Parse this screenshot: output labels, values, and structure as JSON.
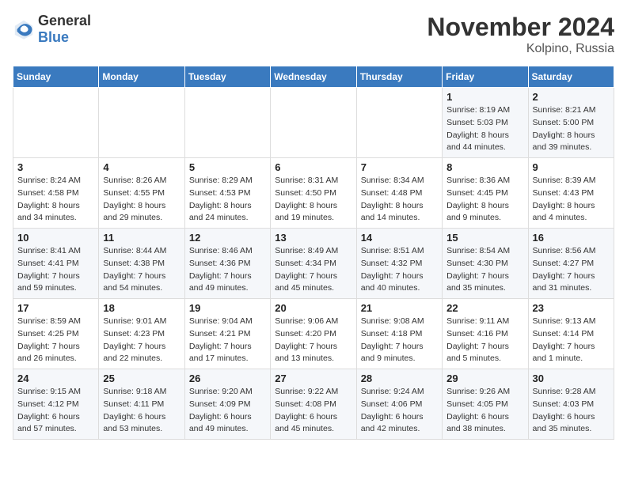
{
  "header": {
    "logo_general": "General",
    "logo_blue": "Blue",
    "month_title": "November 2024",
    "location": "Kolpino, Russia"
  },
  "weekdays": [
    "Sunday",
    "Monday",
    "Tuesday",
    "Wednesday",
    "Thursday",
    "Friday",
    "Saturday"
  ],
  "weeks": [
    [
      {
        "day": "",
        "info": ""
      },
      {
        "day": "",
        "info": ""
      },
      {
        "day": "",
        "info": ""
      },
      {
        "day": "",
        "info": ""
      },
      {
        "day": "",
        "info": ""
      },
      {
        "day": "1",
        "info": "Sunrise: 8:19 AM\nSunset: 5:03 PM\nDaylight: 8 hours and 44 minutes."
      },
      {
        "day": "2",
        "info": "Sunrise: 8:21 AM\nSunset: 5:00 PM\nDaylight: 8 hours and 39 minutes."
      }
    ],
    [
      {
        "day": "3",
        "info": "Sunrise: 8:24 AM\nSunset: 4:58 PM\nDaylight: 8 hours and 34 minutes."
      },
      {
        "day": "4",
        "info": "Sunrise: 8:26 AM\nSunset: 4:55 PM\nDaylight: 8 hours and 29 minutes."
      },
      {
        "day": "5",
        "info": "Sunrise: 8:29 AM\nSunset: 4:53 PM\nDaylight: 8 hours and 24 minutes."
      },
      {
        "day": "6",
        "info": "Sunrise: 8:31 AM\nSunset: 4:50 PM\nDaylight: 8 hours and 19 minutes."
      },
      {
        "day": "7",
        "info": "Sunrise: 8:34 AM\nSunset: 4:48 PM\nDaylight: 8 hours and 14 minutes."
      },
      {
        "day": "8",
        "info": "Sunrise: 8:36 AM\nSunset: 4:45 PM\nDaylight: 8 hours and 9 minutes."
      },
      {
        "day": "9",
        "info": "Sunrise: 8:39 AM\nSunset: 4:43 PM\nDaylight: 8 hours and 4 minutes."
      }
    ],
    [
      {
        "day": "10",
        "info": "Sunrise: 8:41 AM\nSunset: 4:41 PM\nDaylight: 7 hours and 59 minutes."
      },
      {
        "day": "11",
        "info": "Sunrise: 8:44 AM\nSunset: 4:38 PM\nDaylight: 7 hours and 54 minutes."
      },
      {
        "day": "12",
        "info": "Sunrise: 8:46 AM\nSunset: 4:36 PM\nDaylight: 7 hours and 49 minutes."
      },
      {
        "day": "13",
        "info": "Sunrise: 8:49 AM\nSunset: 4:34 PM\nDaylight: 7 hours and 45 minutes."
      },
      {
        "day": "14",
        "info": "Sunrise: 8:51 AM\nSunset: 4:32 PM\nDaylight: 7 hours and 40 minutes."
      },
      {
        "day": "15",
        "info": "Sunrise: 8:54 AM\nSunset: 4:30 PM\nDaylight: 7 hours and 35 minutes."
      },
      {
        "day": "16",
        "info": "Sunrise: 8:56 AM\nSunset: 4:27 PM\nDaylight: 7 hours and 31 minutes."
      }
    ],
    [
      {
        "day": "17",
        "info": "Sunrise: 8:59 AM\nSunset: 4:25 PM\nDaylight: 7 hours and 26 minutes."
      },
      {
        "day": "18",
        "info": "Sunrise: 9:01 AM\nSunset: 4:23 PM\nDaylight: 7 hours and 22 minutes."
      },
      {
        "day": "19",
        "info": "Sunrise: 9:04 AM\nSunset: 4:21 PM\nDaylight: 7 hours and 17 minutes."
      },
      {
        "day": "20",
        "info": "Sunrise: 9:06 AM\nSunset: 4:20 PM\nDaylight: 7 hours and 13 minutes."
      },
      {
        "day": "21",
        "info": "Sunrise: 9:08 AM\nSunset: 4:18 PM\nDaylight: 7 hours and 9 minutes."
      },
      {
        "day": "22",
        "info": "Sunrise: 9:11 AM\nSunset: 4:16 PM\nDaylight: 7 hours and 5 minutes."
      },
      {
        "day": "23",
        "info": "Sunrise: 9:13 AM\nSunset: 4:14 PM\nDaylight: 7 hours and 1 minute."
      }
    ],
    [
      {
        "day": "24",
        "info": "Sunrise: 9:15 AM\nSunset: 4:12 PM\nDaylight: 6 hours and 57 minutes."
      },
      {
        "day": "25",
        "info": "Sunrise: 9:18 AM\nSunset: 4:11 PM\nDaylight: 6 hours and 53 minutes."
      },
      {
        "day": "26",
        "info": "Sunrise: 9:20 AM\nSunset: 4:09 PM\nDaylight: 6 hours and 49 minutes."
      },
      {
        "day": "27",
        "info": "Sunrise: 9:22 AM\nSunset: 4:08 PM\nDaylight: 6 hours and 45 minutes."
      },
      {
        "day": "28",
        "info": "Sunrise: 9:24 AM\nSunset: 4:06 PM\nDaylight: 6 hours and 42 minutes."
      },
      {
        "day": "29",
        "info": "Sunrise: 9:26 AM\nSunset: 4:05 PM\nDaylight: 6 hours and 38 minutes."
      },
      {
        "day": "30",
        "info": "Sunrise: 9:28 AM\nSunset: 4:03 PM\nDaylight: 6 hours and 35 minutes."
      }
    ]
  ]
}
